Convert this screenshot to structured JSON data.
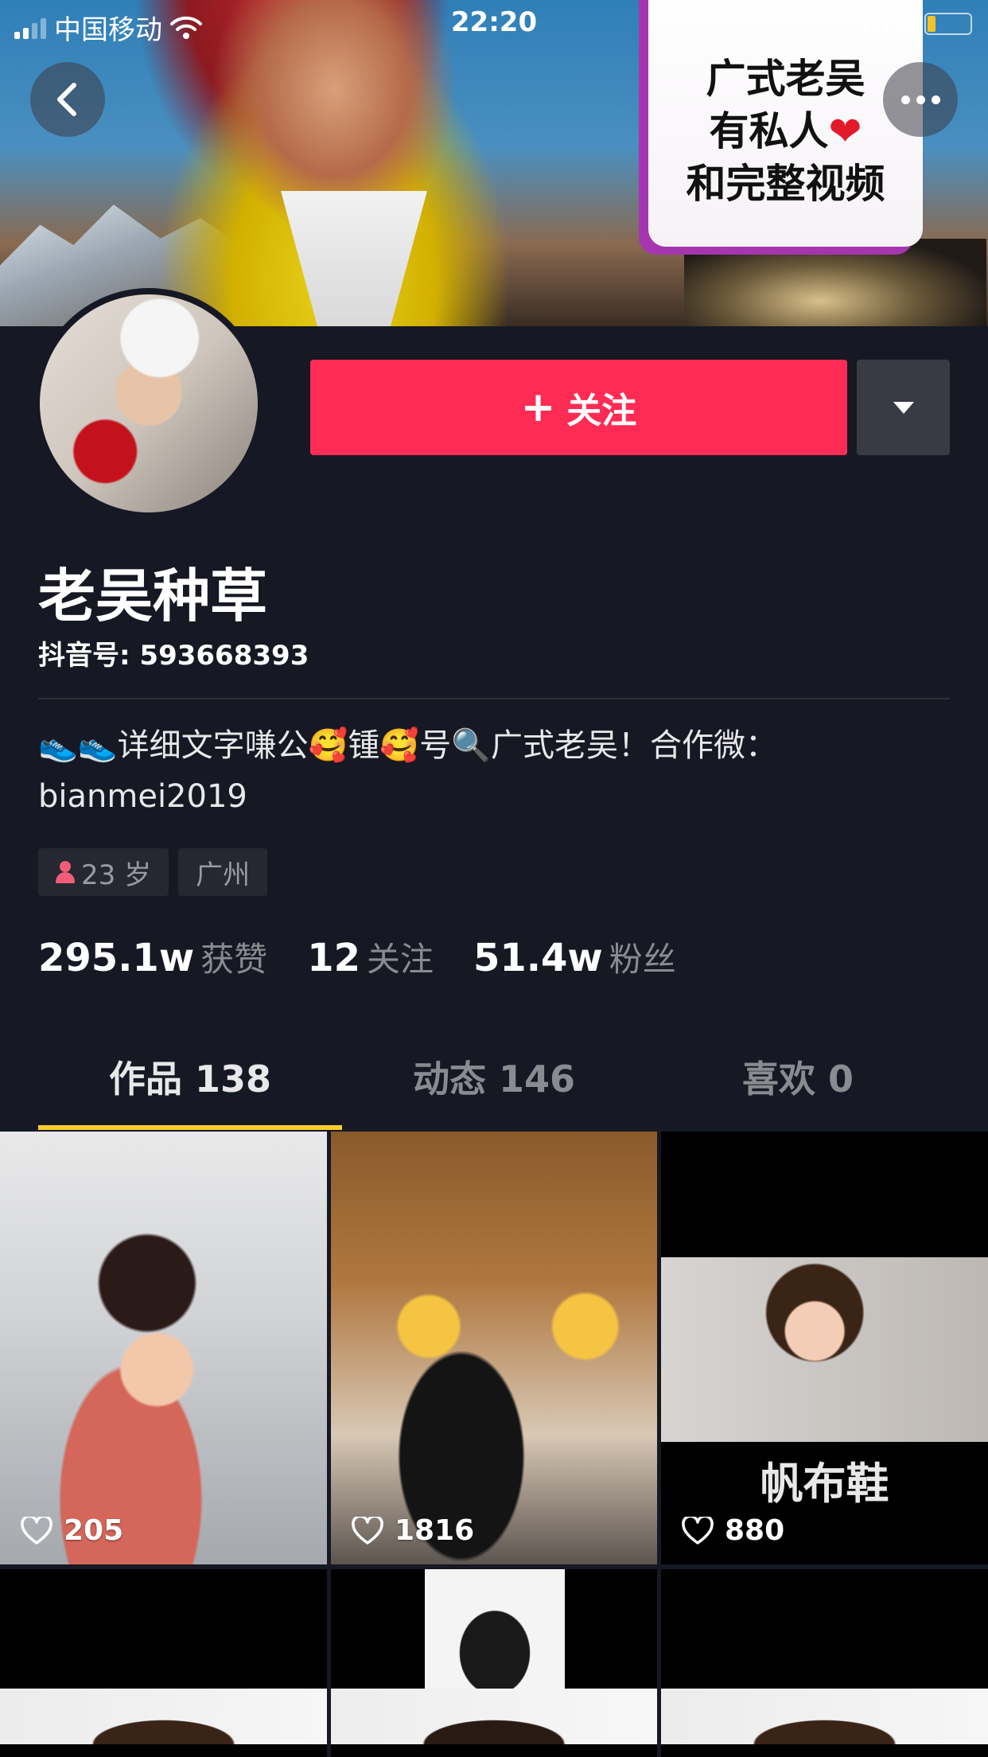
{
  "status_bar": {
    "carrier": "中国移动",
    "time": "22:20",
    "battery": "13%"
  },
  "banner": {
    "poster_line1": "广式老吴",
    "poster_line2": "有私人",
    "poster_line3": "和完整视频"
  },
  "profile": {
    "follow_label": "关注",
    "name": "老吴种草",
    "douyin_id": "抖音号: 593668393",
    "bio_line1": "👟👟详细文字嗛公🥰锺🥰号🔍广式老吴！合作微：",
    "bio_line2": "bianmei2019",
    "tags": {
      "age": "23 岁",
      "city": "广州"
    },
    "stats": {
      "likes_value": "295.1w",
      "likes_label": "获赞",
      "following_value": "12",
      "following_label": "关注",
      "followers_value": "51.4w",
      "followers_label": "粉丝"
    }
  },
  "tabs": [
    {
      "label": "作品 138",
      "active": true
    },
    {
      "label": "动态 146",
      "active": false
    },
    {
      "label": "喜欢 0",
      "active": false
    }
  ],
  "videos": [
    {
      "likes": "205"
    },
    {
      "likes": "1816"
    },
    {
      "likes": "880",
      "caption": "帆布鞋"
    }
  ],
  "colors": {
    "background": "#161823",
    "accent": "#fe2c55",
    "tab_indicator": "#facd2d"
  },
  "icons": [
    "back-icon",
    "more-icon",
    "plus-icon",
    "dropdown-icon",
    "female-icon",
    "heart-icon",
    "wifi-icon",
    "signal-icon",
    "battery-icon"
  ]
}
